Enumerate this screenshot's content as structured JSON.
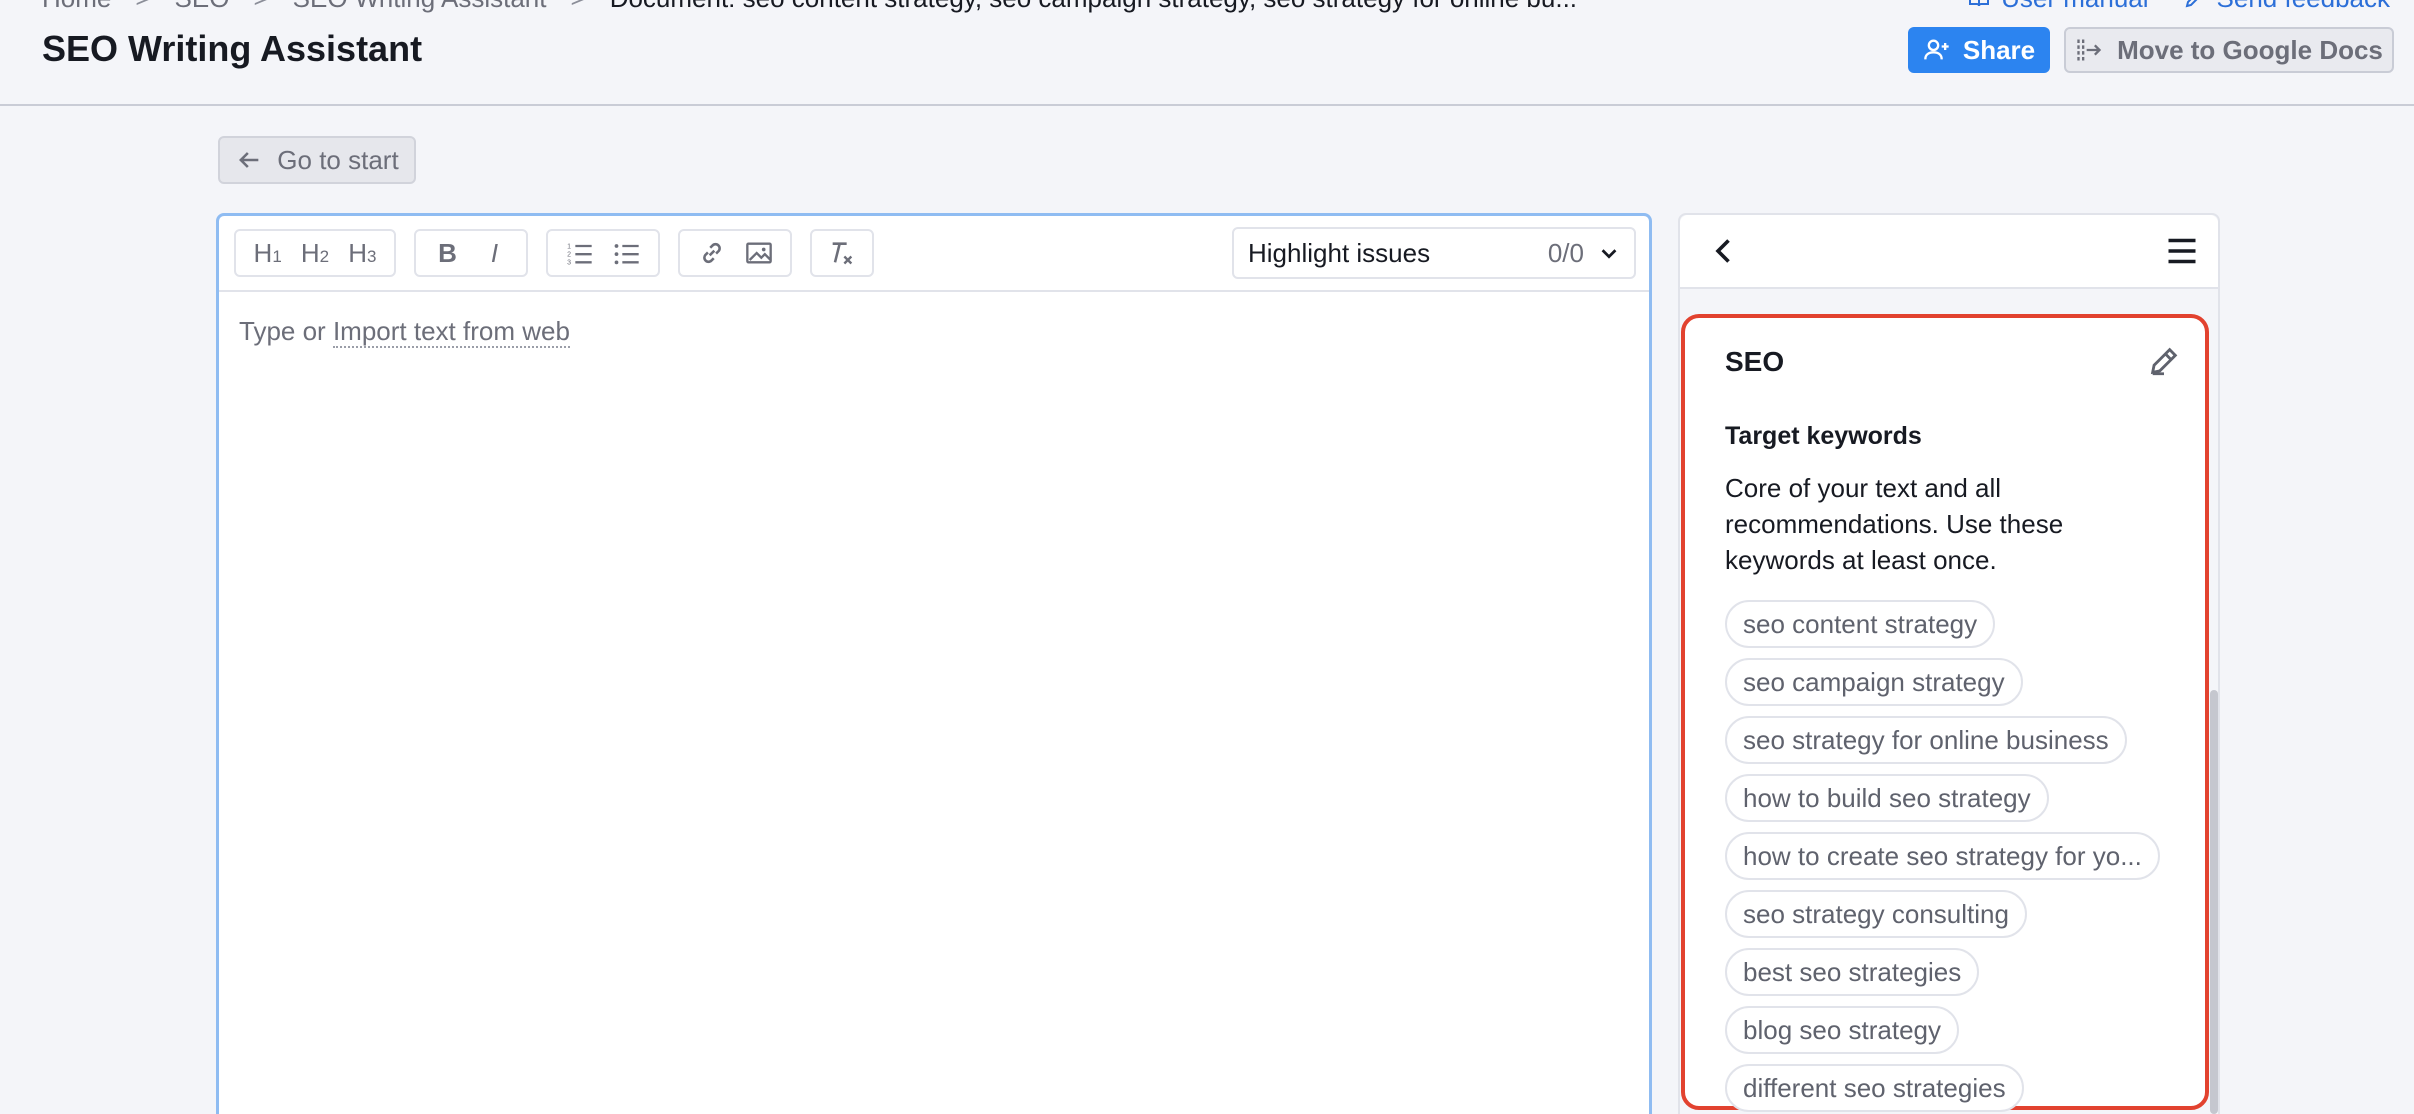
{
  "breadcrumb": {
    "items": [
      "Home",
      "SEO",
      "SEO Writing Assistant",
      "Document: seo content strategy, seo campaign strategy, seo strategy for online bu..."
    ],
    "separator": ">"
  },
  "top_links": {
    "user_manual": "User manual",
    "send_feedback": "Send feedback"
  },
  "header": {
    "title": "SEO Writing Assistant",
    "share_label": "Share",
    "gdocs_label": "Move to Google Docs"
  },
  "go_start_label": "Go to start",
  "toolbar": {
    "h1": "H",
    "h1_sub": "1",
    "h2": "H",
    "h2_sub": "2",
    "h3": "H",
    "h3_sub": "3",
    "bold": "B",
    "italic": "I",
    "highlight_label": "Highlight issues",
    "highlight_count": "0/0"
  },
  "editor": {
    "placeholder_prefix": "Type or",
    "import_link": "Import text from web"
  },
  "seo_panel": {
    "title": "SEO",
    "target_title": "Target keywords",
    "target_desc": "Core of your text and all recommendations. Use these keywords at least once.",
    "keywords": [
      "seo content strategy",
      "seo campaign strategy",
      "seo strategy for online business",
      "how to build seo strategy",
      "how to create seo strategy for yo...",
      "seo strategy consulting",
      "best seo strategies",
      "blog seo strategy",
      "different seo strategies"
    ]
  },
  "colors": {
    "accent": "#2c84f0",
    "highlight_border": "#e2422f",
    "editor_focus": "#8fbcf2"
  }
}
